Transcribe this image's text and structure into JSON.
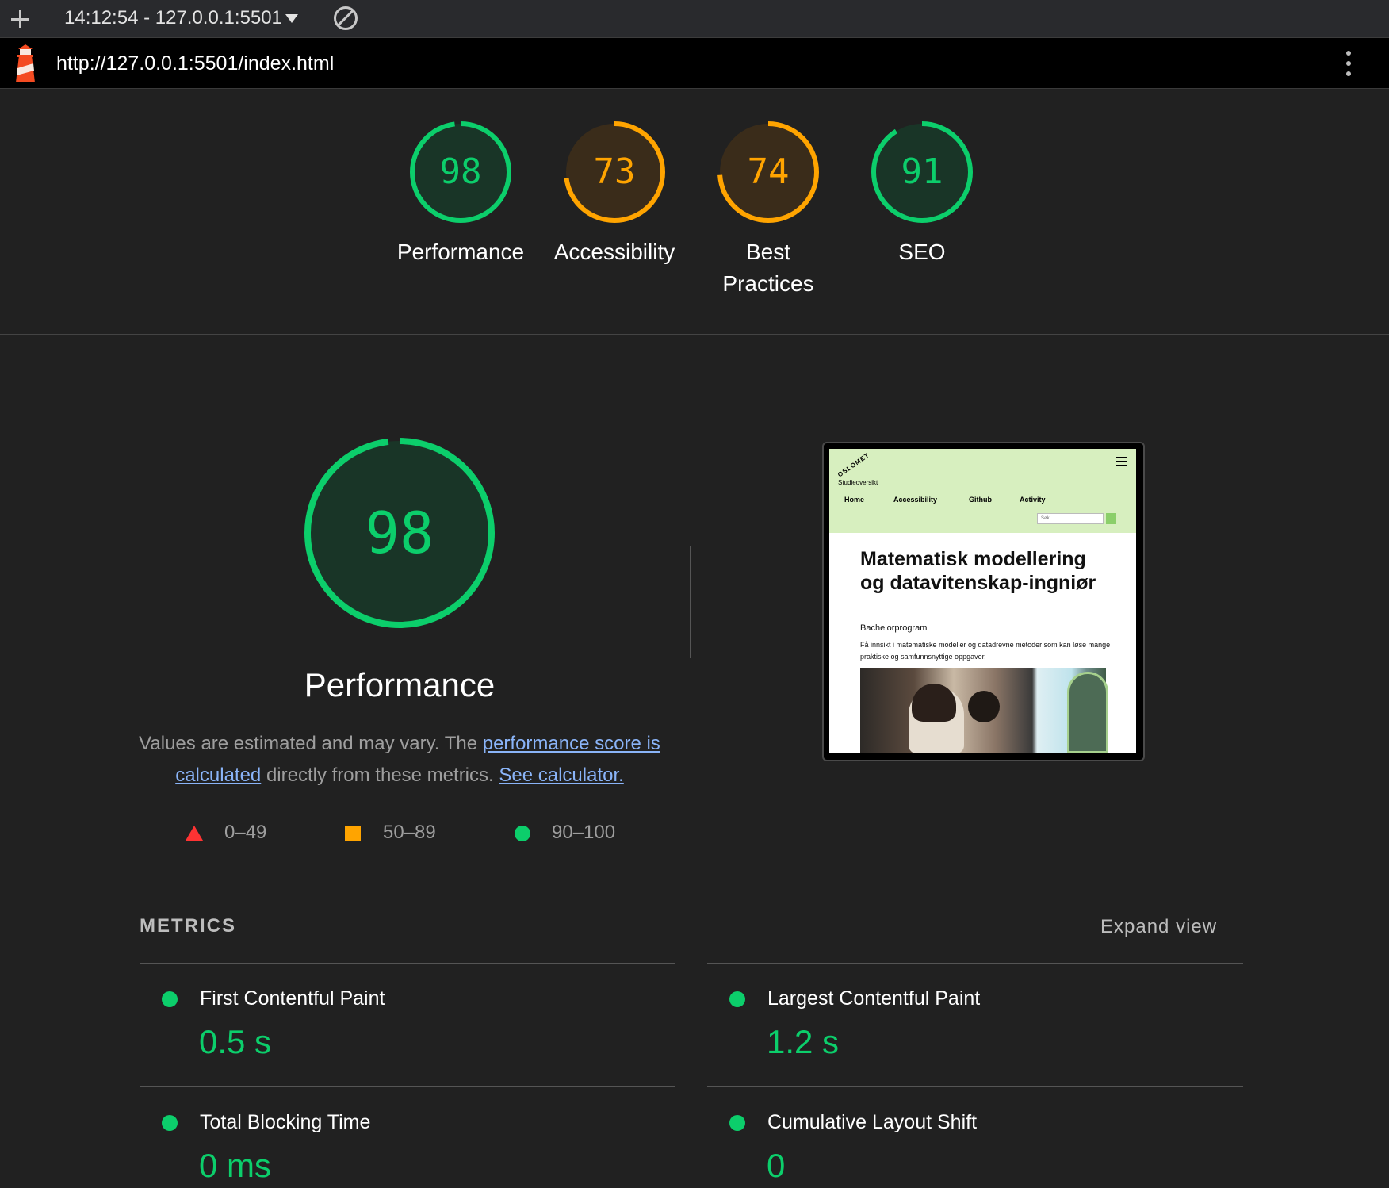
{
  "toolbar": {
    "session": "14:12:54 - 127.0.0.1:5501"
  },
  "urlbar": {
    "url": "http://127.0.0.1:5501/index.html"
  },
  "colors": {
    "pass": "#0cce6b",
    "average": "#ffa400",
    "fail": "#ff3333",
    "link": "#8ab4f8"
  },
  "categories": [
    {
      "label": "Performance",
      "score": "98",
      "rating": "pass"
    },
    {
      "label": "Accessibility",
      "score": "73",
      "rating": "average"
    },
    {
      "label": "Best Practices",
      "score": "74",
      "rating": "average"
    },
    {
      "label": "SEO",
      "score": "91",
      "rating": "pass"
    }
  ],
  "performance": {
    "score": "98",
    "title": "Performance",
    "desc_prefix": "Values are estimated and may vary. The ",
    "desc_link1": "performance score is calculated",
    "desc_middle": " directly from these metrics. ",
    "desc_link2": "See calculator."
  },
  "legend": {
    "fail": "0–49",
    "average": "50–89",
    "pass": "90–100"
  },
  "screenshot": {
    "logo": "OSLOMET",
    "subtitle": "Studieoversikt",
    "nav": [
      "Home",
      "Accessibility",
      "Github",
      "Activity"
    ],
    "search_placeholder": "Søk...",
    "heading": "Matematisk modellering og datavitenskap-ingniør",
    "program": "Bachelorprogram",
    "intro": "Få innsikt i matematiske modeller og datadrevne metoder som kan løse mange praktiske og samfunnsnyttige oppgaver."
  },
  "metrics": {
    "heading": "METRICS",
    "expand": "Expand view",
    "items": [
      {
        "label": "First Contentful Paint",
        "value": "0.5 s"
      },
      {
        "label": "Largest Contentful Paint",
        "value": "1.2 s"
      },
      {
        "label": "Total Blocking Time",
        "value": "0 ms"
      },
      {
        "label": "Cumulative Layout Shift",
        "value": "0"
      }
    ]
  }
}
